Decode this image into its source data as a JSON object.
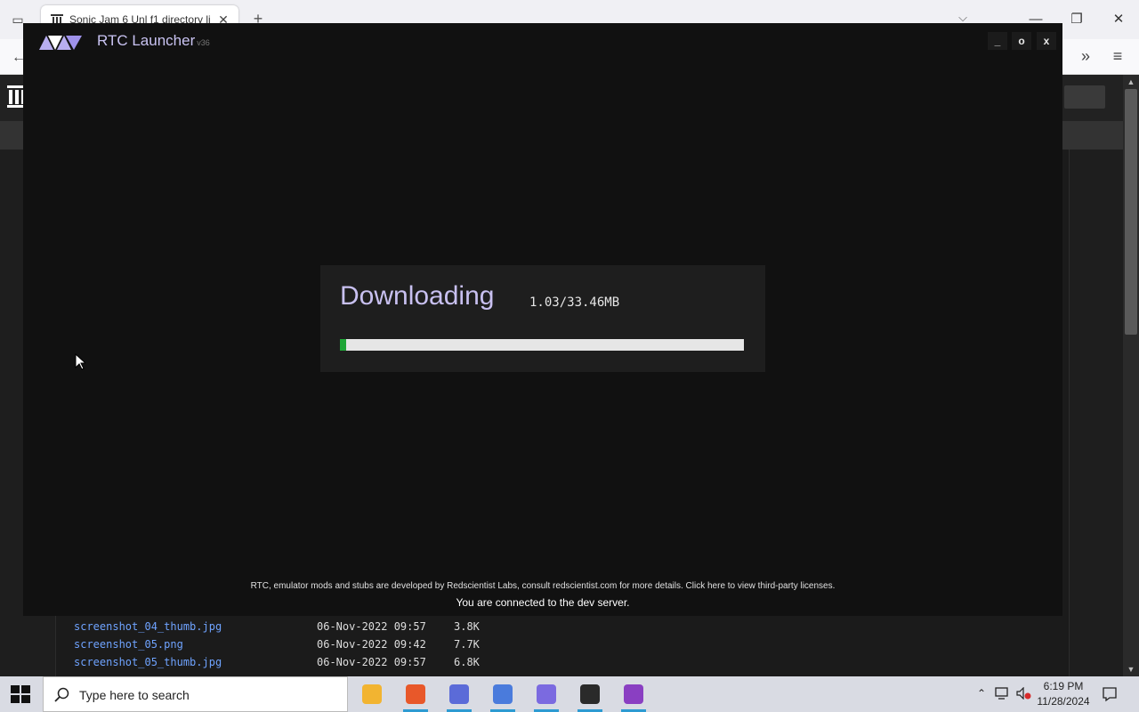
{
  "browser": {
    "tab_title": "Sonic Jam 6 Unl f1 directory li",
    "file_rows": [
      {
        "name": "screenshot_04_thumb.jpg",
        "date": "06-Nov-2022 09:57",
        "size": "3.8K"
      },
      {
        "name": "screenshot_05.png",
        "date": "06-Nov-2022 09:42",
        "size": "7.7K"
      },
      {
        "name": "screenshot_05_thumb.jpg",
        "date": "06-Nov-2022 09:57",
        "size": "6.8K"
      }
    ]
  },
  "launcher": {
    "title": "RTC Launcher",
    "version": "v36",
    "controls": {
      "minimize": "_",
      "maximize": "o",
      "close": "x"
    },
    "download": {
      "heading": "Downloading",
      "size_text": "1.03/33.46MB",
      "downloaded_mb": 1.03,
      "total_mb": 33.46
    },
    "credit": "RTC, emulator mods and stubs are developed by Redscientist Labs, consult redscientist.com for more details. Click here to view third-party licenses.",
    "status": "You are connected to the dev server.",
    "colors": {
      "accent": "#c8c0f0",
      "progress": "#1fa637",
      "track": "#e6e6e6"
    }
  },
  "taskbar": {
    "search_placeholder": "Type here to search",
    "apps": [
      {
        "name": "file-explorer-icon",
        "color": "#f2b431"
      },
      {
        "name": "firefox-icon",
        "color": "#e8582a"
      },
      {
        "name": "app-icon-blue",
        "color": "#5b6bd8"
      },
      {
        "name": "app-icon-dome",
        "color": "#4a7bdc"
      },
      {
        "name": "rtc-launcher-icon",
        "color": "#7b6ae0"
      },
      {
        "name": "app-icon-shield",
        "color": "#2a2a2a"
      },
      {
        "name": "app-icon-purple",
        "color": "#8a3fc2"
      }
    ],
    "time": "6:19 PM",
    "date": "11/28/2024"
  }
}
